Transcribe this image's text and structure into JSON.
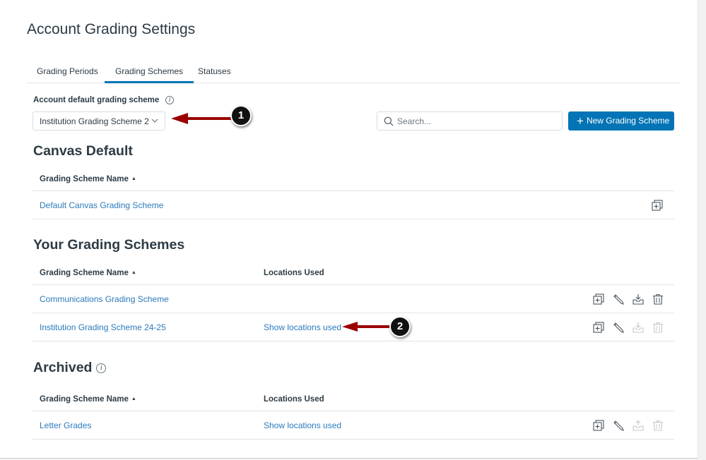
{
  "page": {
    "title": "Account Grading Settings"
  },
  "tabs": [
    {
      "label": "Grading Periods",
      "active": false
    },
    {
      "label": "Grading Schemes",
      "active": true
    },
    {
      "label": "Statuses",
      "active": false
    }
  ],
  "default_scheme": {
    "label": "Account default grading scheme",
    "info_icon": "info-icon",
    "selected_value": "Institution Grading Scheme 2"
  },
  "search": {
    "placeholder": "Search...",
    "value": ""
  },
  "new_button": {
    "icon": "plus",
    "label": "New Grading Scheme"
  },
  "sections": {
    "canvas_default": {
      "title": "Canvas Default",
      "columns": [
        "Grading Scheme Name"
      ],
      "rows": [
        {
          "name": "Default Canvas Grading Scheme",
          "actions": [
            "duplicate"
          ]
        }
      ]
    },
    "yours": {
      "title": "Your Grading Schemes",
      "columns": [
        "Grading Scheme Name",
        "Locations Used"
      ],
      "rows": [
        {
          "name": "Communications Grading Scheme",
          "locations": "",
          "actions": [
            "duplicate",
            "edit",
            "archive",
            "delete"
          ],
          "archive_enabled": true,
          "delete_enabled": true
        },
        {
          "name": "Institution Grading Scheme 24-25",
          "locations": "Show locations used",
          "actions": [
            "duplicate",
            "edit",
            "archive",
            "delete"
          ],
          "archive_enabled": false,
          "delete_enabled": false
        }
      ]
    },
    "archived": {
      "title": "Archived",
      "columns": [
        "Grading Scheme Name",
        "Locations Used"
      ],
      "rows": [
        {
          "name": "Letter Grades",
          "locations": "Show locations used",
          "actions": [
            "duplicate",
            "edit",
            "unarchive",
            "delete"
          ],
          "unarchive_enabled": false,
          "delete_enabled": false
        }
      ]
    }
  },
  "sort_indicator": "▲",
  "annotations": [
    {
      "number": "1",
      "target": "default-scheme-select"
    },
    {
      "number": "2",
      "target": "show-locations-used-link"
    }
  ],
  "colors": {
    "accent": "#0374b5",
    "link": "#2b7abc",
    "text": "#2d3b45",
    "annotation_arrow": "#9b0000"
  }
}
